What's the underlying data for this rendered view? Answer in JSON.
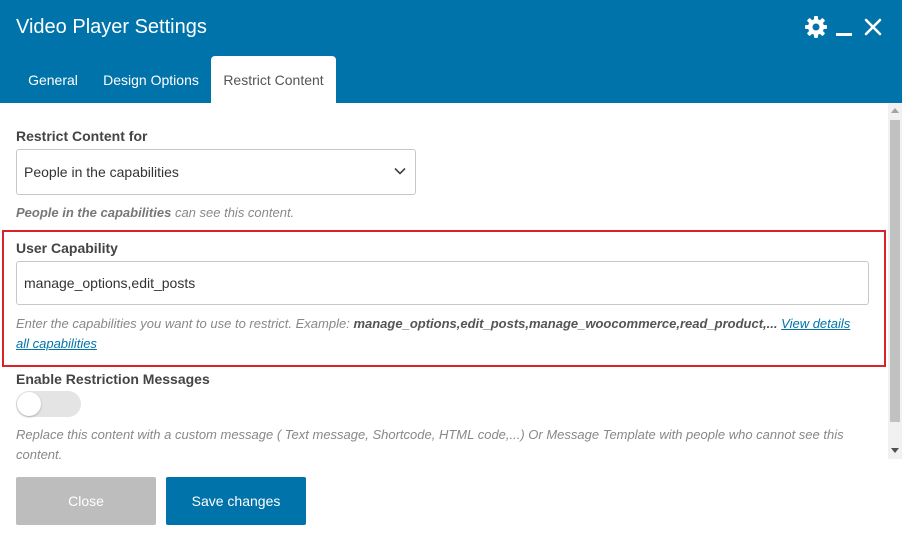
{
  "window": {
    "title": "Video Player Settings",
    "accent_color": "#0073aa"
  },
  "header_icons": {
    "settings": "gear-icon",
    "minimize": "minimize-icon",
    "close": "close-icon"
  },
  "tabs": [
    {
      "label": "General",
      "active": false
    },
    {
      "label": "Design Options",
      "active": false
    },
    {
      "label": "Restrict Content",
      "active": true
    }
  ],
  "restrict_for": {
    "label": "Restrict Content for",
    "selected": "People in the capabilities",
    "help_em": "People in the capabilities",
    "help_rest": " can see this content."
  },
  "user_capability": {
    "label": "User Capability",
    "value": "manage_options,edit_posts",
    "help_prefix": "Enter the capabilities you want to use to restrict. Example: ",
    "help_example": "manage_options,edit_posts,manage_woocommerce,read_product,...",
    "help_link_part1": "View details",
    "help_link_part2": "all capabilities",
    "highlight_color": "#d9222a"
  },
  "restriction_messages": {
    "label": "Enable Restriction Messages",
    "enabled": false,
    "help_line1": "Replace this content with a custom message ( Text message, Shortcode, HTML code,...) Or Message Template with people who cannot see this",
    "help_line2": "content."
  },
  "footer": {
    "close_label": "Close",
    "save_label": "Save changes"
  }
}
